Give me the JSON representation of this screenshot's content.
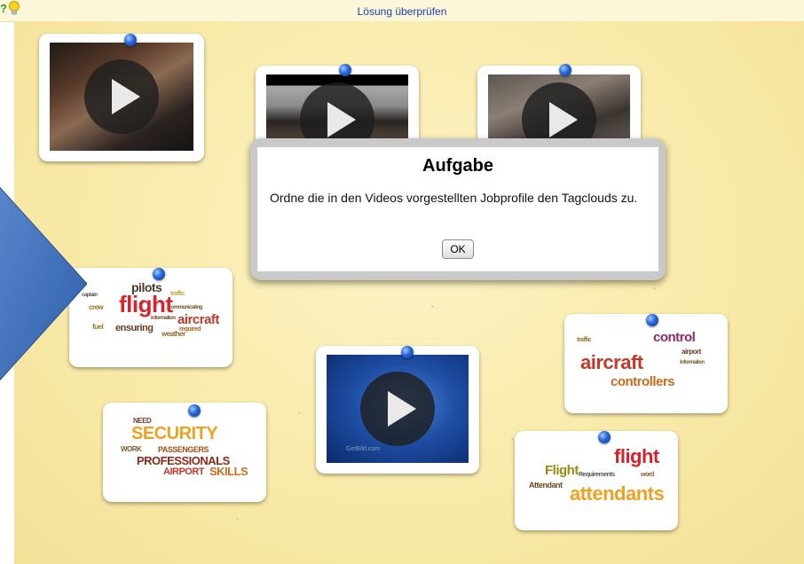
{
  "topbar": {
    "title": "Lösung überprüfen",
    "help_glyph": "?",
    "icons": [
      "help-icon",
      "lightbulb-icon"
    ]
  },
  "dialog": {
    "heading": "Aufgabe",
    "message": "Ordne die in den Videos vorgestellten Jobprofile den Tagclouds zu.",
    "ok_label": "OK"
  },
  "arrow": {
    "color": "#3d6fb8"
  },
  "pin_color": "#2566d6",
  "videos": [
    {
      "id": "video-1",
      "icon": "play-icon"
    },
    {
      "id": "video-2",
      "icon": "play-icon"
    },
    {
      "id": "video-3",
      "icon": "play-icon"
    },
    {
      "id": "video-4",
      "icon": "play-icon",
      "watermark": "GetBild.com"
    }
  ],
  "tagclouds": [
    {
      "id": "tagcloud-pilots",
      "words": [
        "pilots",
        "flight",
        "aircraft",
        "ensuring",
        "weather",
        "required",
        "crew",
        "fuel",
        "traffic",
        "captain",
        "communicating",
        "information"
      ]
    },
    {
      "id": "tagcloud-controllers",
      "words": [
        "control",
        "aircraft",
        "controllers",
        "airport",
        "traffic",
        "information"
      ]
    },
    {
      "id": "tagcloud-security",
      "words": [
        "SECURITY",
        "PASSENGERS",
        "PROFESSIONALS",
        "AIRPORT",
        "SKILLS",
        "WORK",
        "NEED"
      ]
    },
    {
      "id": "tagcloud-attendants",
      "words": [
        "flight",
        "Flight",
        "Attendant",
        "attendants",
        "Requirements",
        "word"
      ]
    }
  ]
}
